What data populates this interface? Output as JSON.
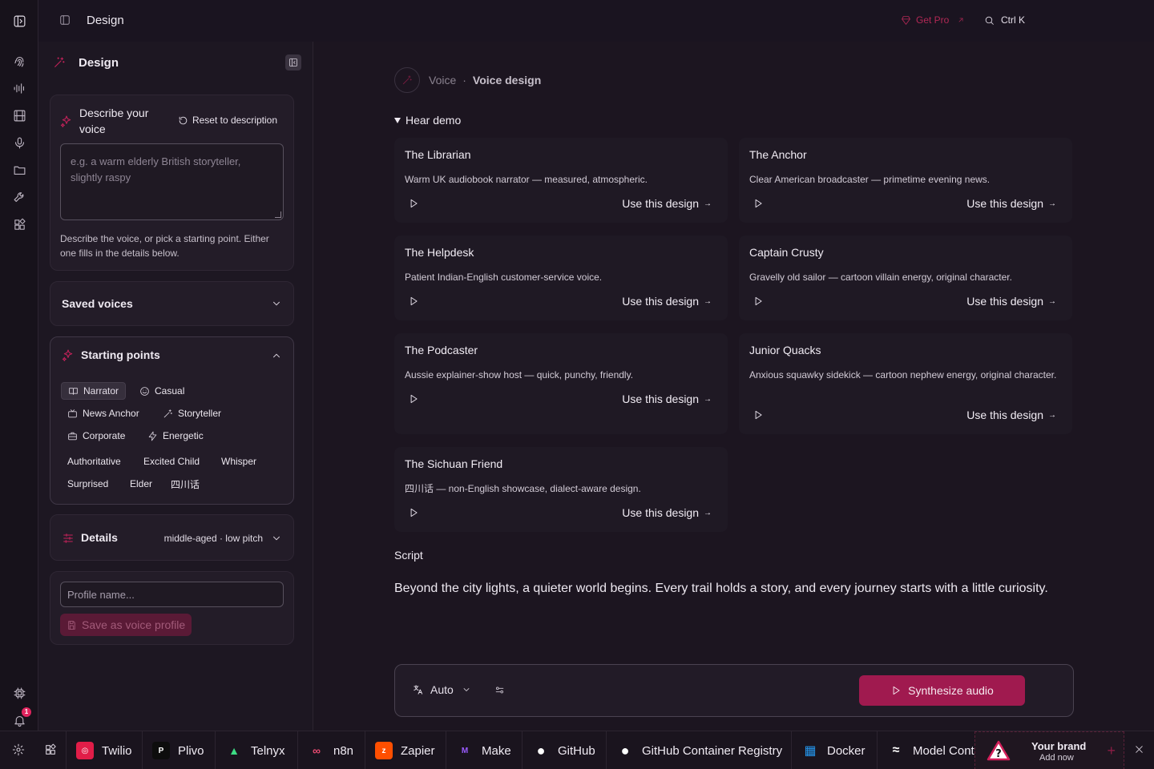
{
  "header": {
    "title": "Design",
    "get_pro": "Get Pro",
    "search_shortcut": "Ctrl K"
  },
  "rail": {
    "notification_count": "1"
  },
  "panel": {
    "title": "Design",
    "describe": {
      "title": "Describe your voice",
      "reset_label": "Reset to description",
      "placeholder": "e.g. a warm elderly British storyteller, slightly raspy",
      "help": "Describe the voice, or pick a starting point. Either one fills in the details below."
    },
    "saved_voices": {
      "label": "Saved voices"
    },
    "starting_points": {
      "label": "Starting points",
      "chips": [
        {
          "label": "Narrator",
          "icon": "book-icon",
          "active": true
        },
        {
          "label": "Casual",
          "icon": "smile-icon"
        },
        {
          "label": "News Anchor",
          "icon": "tv-icon"
        },
        {
          "label": "Storyteller",
          "icon": "wand-icon"
        },
        {
          "label": "Corporate",
          "icon": "briefcase-icon"
        },
        {
          "label": "Energetic",
          "icon": "bolt-icon"
        },
        {
          "label": "Authoritative"
        },
        {
          "label": "Excited Child"
        },
        {
          "label": "Whisper"
        },
        {
          "label": "Surprised"
        },
        {
          "label": "Elder"
        },
        {
          "label": "四川话"
        }
      ]
    },
    "details": {
      "label": "Details",
      "value": "middle-aged · low pitch"
    },
    "profile": {
      "placeholder": "Profile name...",
      "save_label": "Save as voice profile"
    }
  },
  "main": {
    "breadcrumb": {
      "parent": "Voice",
      "separator": "·",
      "current": "Voice design"
    },
    "demo_heading": "Hear demo",
    "use_label": "Use this design",
    "voices": [
      {
        "name": "The Librarian",
        "desc": "Warm UK audiobook narrator — measured, atmospheric."
      },
      {
        "name": "The Anchor",
        "desc": "Clear American broadcaster — primetime evening news."
      },
      {
        "name": "The Helpdesk",
        "desc": "Patient Indian-English customer-service voice."
      },
      {
        "name": "Captain Crusty",
        "desc": "Gravelly old sailor — cartoon villain energy, original character."
      },
      {
        "name": "The Podcaster",
        "desc": "Aussie explainer-show host — quick, punchy, friendly."
      },
      {
        "name": "Junior Quacks",
        "desc": "Anxious squawky sidekick — cartoon nephew energy, original character."
      },
      {
        "name": "The Sichuan Friend",
        "desc": "四川话 — non-English showcase, dialect-aware design."
      }
    ],
    "script_label": "Script",
    "script_text": "Beyond the city lights, a quieter world begins. Every trail holds a story, and every journey starts with a little curiosity.",
    "composer": {
      "language": "Auto",
      "synthesize_label": "Synthesize audio"
    }
  },
  "integrations": {
    "items": [
      {
        "name": "Twilio",
        "bg": "#e11d48",
        "fg": "#ffffff",
        "glyph": "◎"
      },
      {
        "name": "Plivo",
        "bg": "#111111",
        "fg": "#ffffff",
        "glyph": "P"
      },
      {
        "name": "Telnyx",
        "bg": "transparent",
        "fg": "#3ddc84",
        "glyph": "▲"
      },
      {
        "name": "n8n",
        "bg": "transparent",
        "fg": "#ea4b71",
        "glyph": "∞"
      },
      {
        "name": "Zapier",
        "bg": "#ff4f00",
        "fg": "#ffffff",
        "glyph": "z"
      },
      {
        "name": "Make",
        "bg": "transparent",
        "fg": "#9b5cff",
        "glyph": "M"
      },
      {
        "name": "GitHub",
        "bg": "transparent",
        "fg": "#ffffff",
        "glyph": "●"
      },
      {
        "name": "GitHub Container Registry",
        "bg": "transparent",
        "fg": "#ffffff",
        "glyph": "●"
      },
      {
        "name": "Docker",
        "bg": "transparent",
        "fg": "#2496ed",
        "glyph": "▦"
      },
      {
        "name": "Model Context",
        "bg": "transparent",
        "fg": "#ffffff",
        "glyph": "≈"
      }
    ],
    "brand": {
      "title": "Your brand",
      "subtitle": "Add now"
    }
  },
  "colors": {
    "accent": "#a01a4f",
    "accent_text": "#c4225a",
    "background": "#1c1520"
  }
}
